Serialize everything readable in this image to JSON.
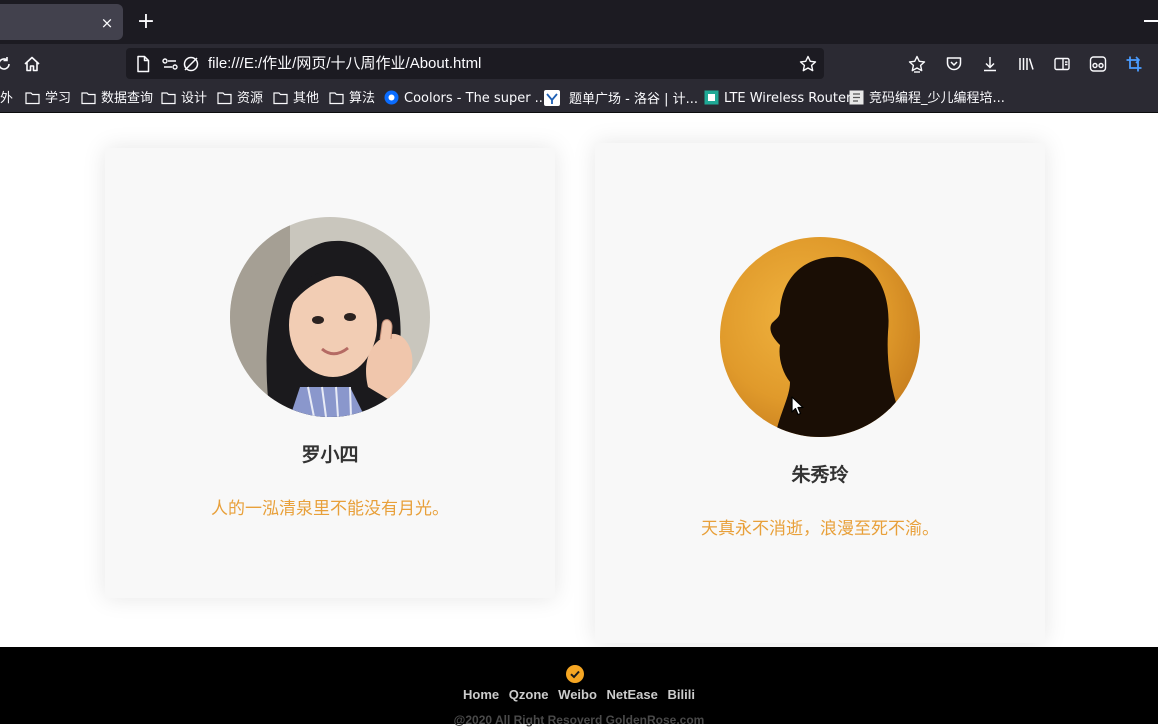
{
  "browser": {
    "tab": {
      "close_glyph": "×",
      "new_tab_glyph": "+"
    },
    "address": "file:///E:/作业/网页/十八周作业/About.html",
    "icons": {
      "left": [
        "reload-icon",
        "home-icon",
        "page-icon",
        "permissions-icon",
        "tracking-protection-icon"
      ],
      "right": [
        "bookmark-star-icon",
        "extensions-icon",
        "pocket-icon",
        "downloads-icon",
        "library-icon",
        "sidebar-icon",
        "reader-icon",
        "screenshot-icon"
      ]
    },
    "bookmarks": [
      {
        "label": "外",
        "icon": "folder-icon"
      },
      {
        "label": "学习",
        "icon": "folder-icon"
      },
      {
        "label": "数据查询",
        "icon": "folder-icon"
      },
      {
        "label": "设计",
        "icon": "folder-icon"
      },
      {
        "label": "资源",
        "icon": "folder-icon"
      },
      {
        "label": "其他",
        "icon": "folder-icon"
      },
      {
        "label": "算法",
        "icon": "folder-icon"
      },
      {
        "label": "Coolors - The super ...",
        "icon": "coolors-icon"
      },
      {
        "label": "题单广场 - 洛谷 | 计...",
        "icon": "luogu-icon"
      },
      {
        "label": "LTE Wireless Router",
        "icon": "router-icon"
      },
      {
        "label": "竞码编程_少儿编程培...",
        "icon": "page-icon"
      }
    ]
  },
  "cards": [
    {
      "name": "罗小四",
      "quote": "人的一泓清泉里不能没有月光。",
      "avatar": "portrait-photo"
    },
    {
      "name": "朱秀玲",
      "quote": "天真永不消逝，浪漫至死不渝。",
      "avatar": "silhouette-photo"
    }
  ],
  "footer": {
    "links": [
      "Home",
      "Qzone",
      "Weibo",
      "NetEase",
      "Bilili"
    ],
    "copyright": "@2020 All Right Resoverd GoldenRose.com"
  },
  "colors": {
    "accent": "#e8a03a",
    "footer_bg": "#000000",
    "card_bg": "#f8f8f8",
    "chrome_dark": "#1c1b22",
    "chrome": "#2b2a33"
  }
}
